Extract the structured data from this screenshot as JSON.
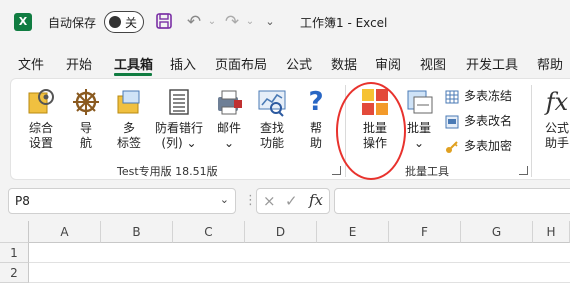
{
  "titlebar": {
    "app_logo_letter": "X",
    "autosave_label": "自动保存",
    "autosave_state": "关",
    "document_title": "工作簿1  -  Excel"
  },
  "tabs": [
    "文件",
    "开始",
    "工具箱",
    "插入",
    "页面布局",
    "公式",
    "数据",
    "审阅",
    "视图",
    "开发工具",
    "帮助"
  ],
  "active_tab": "工具箱",
  "ribbon": {
    "group1": {
      "label": "Test专用版 18.51版",
      "buttons": [
        {
          "line1": "综合",
          "line2": "设置"
        },
        {
          "line1": "导",
          "line2": "航"
        },
        {
          "line1": "多",
          "line2": "标签"
        },
        {
          "line1": "防看错行",
          "line2": "(列) ⌄"
        },
        {
          "line1": "邮件",
          "line2": "⌄"
        },
        {
          "line1": "查找",
          "line2": "功能"
        },
        {
          "line1": "帮",
          "line2": "助"
        }
      ]
    },
    "group2": {
      "label": "批量工具",
      "buttons": [
        {
          "line1": "批量",
          "line2": "操作"
        },
        {
          "line1": "批量",
          "line2": "⌄"
        }
      ],
      "small_buttons": [
        "多表冻结",
        "多表改名",
        "多表加密"
      ]
    },
    "group3": {
      "buttons": [
        {
          "line1": "公式",
          "line2": "助手"
        }
      ]
    }
  },
  "formula_bar": {
    "name_box": "P8",
    "cancel_icon": "×",
    "enter_icon": "✓",
    "fx_label": "fx",
    "content": ""
  },
  "grid": {
    "columns": [
      "A",
      "B",
      "C",
      "D",
      "E",
      "F",
      "G",
      "H"
    ],
    "rows": [
      "1",
      "2"
    ]
  }
}
